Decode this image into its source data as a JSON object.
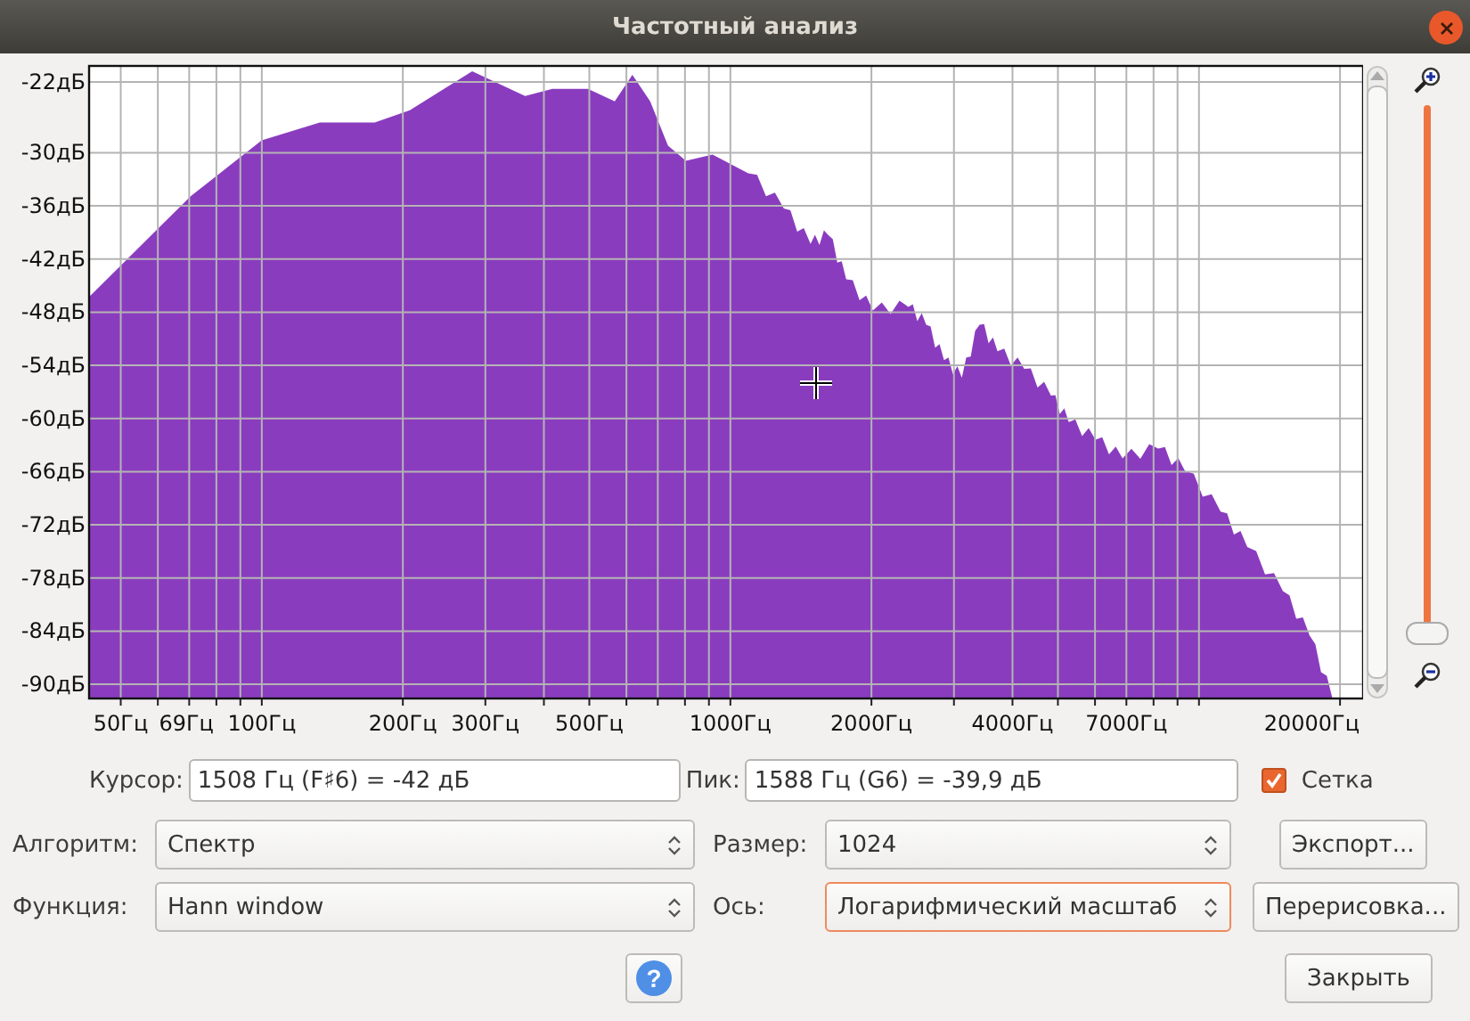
{
  "window": {
    "title": "Частотный анализ"
  },
  "spectrum": {
    "y_labels": [
      "-22дБ",
      "-30дБ",
      "-36дБ",
      "-42дБ",
      "-48дБ",
      "-54дБ",
      "-60дБ",
      "-66дБ",
      "-72дБ",
      "-78дБ",
      "-84дБ",
      "-90дБ"
    ],
    "x_labels": [
      "50Гц",
      "69Гц",
      "100Гц",
      "200Гц",
      "300Гц",
      "500Гц",
      "1000Гц",
      "2000Гц",
      "4000Гц",
      "7000Гц",
      "20000Гц"
    ]
  },
  "zoom": {
    "level": 0
  },
  "cursor": {
    "label": "Курсор:",
    "value": "1508 Гц (F♯6) = -42 дБ"
  },
  "peak": {
    "label": "Пик:",
    "value": "1588 Гц (G6) = -39,9 дБ"
  },
  "grid": {
    "label": "Сетка",
    "checked": true
  },
  "algorithm": {
    "label": "Алгоритм:",
    "value": "Спектр"
  },
  "size": {
    "label": "Размер:",
    "value": "1024"
  },
  "export_button": "Экспорт...",
  "function": {
    "label": "Функция:",
    "value": "Hann window"
  },
  "axis": {
    "label": "Ось:",
    "value": "Логарифмический масштаб",
    "focused": true
  },
  "redraw_button": "Перерисовка...",
  "help_button": "?",
  "close_button": "Закрыть"
}
